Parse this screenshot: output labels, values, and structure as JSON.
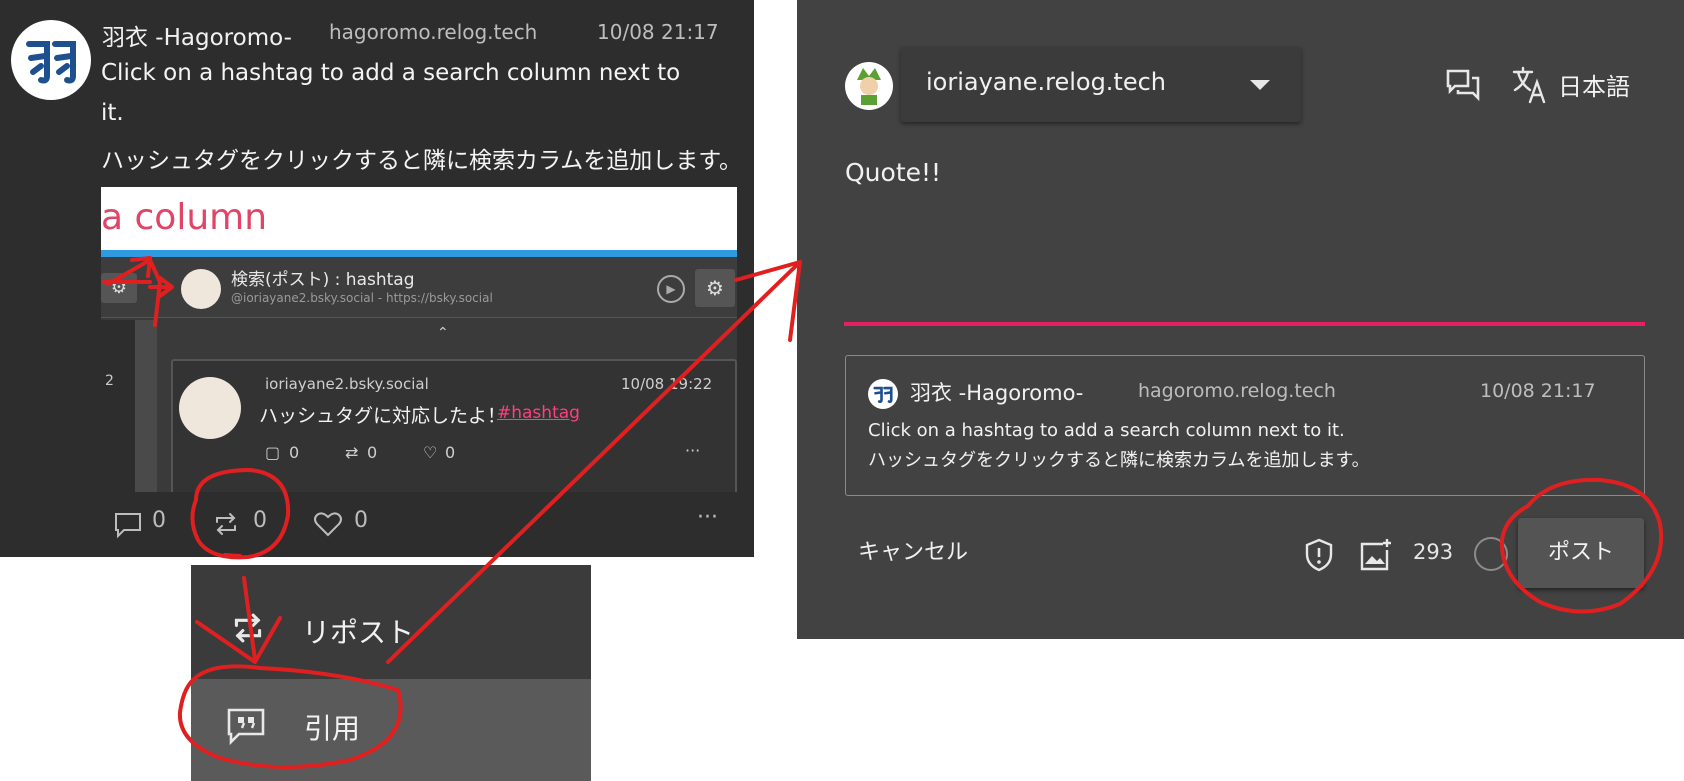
{
  "post": {
    "author_name": "羽衣 -Hagoromo-",
    "handle": "hagoromo.relog.tech",
    "time": "10/08 21:17",
    "text_lines": [
      "Click on a hashtag to add a search column next to",
      "it.",
      "ハッシュタグをクリックすると隣に検索カラムを追加します。"
    ],
    "avatar_glyph": "羽",
    "image": {
      "banner_text": "a column",
      "column_title": "検索(ポスト) : hashtag",
      "column_subtitle": "@ioriayane2.bsky.social - https://bsky.social",
      "left_column_number": "2",
      "card_handle": "ioriayane2.bsky.social",
      "card_time": "10/08 19:22",
      "card_text": "ハッシュタグに対応したよ！",
      "card_hashtag": "#hashtag",
      "card_reply_count": "0",
      "card_repost_count": "0",
      "card_like_count": "0",
      "card_more": "···"
    },
    "actions": {
      "reply_count": "0",
      "repost_count": "0",
      "like_count": "0",
      "more": "···"
    }
  },
  "repost_menu": {
    "repost_label": "リポスト",
    "quote_label": "引用"
  },
  "compose": {
    "account": "ioriayane.relog.tech",
    "language": "日本語",
    "text": "Quote!!",
    "quoted": {
      "author_name": "羽衣 -Hagoromo-",
      "handle": "hagoromo.relog.tech",
      "time": "10/08 21:17",
      "text_lines": [
        "Click on a hashtag to add a search column next to it.",
        "ハッシュタグをクリックすると隣に検索カラムを追加します。"
      ]
    },
    "cancel_label": "キャンセル",
    "char_count": "293",
    "post_label": "ポスト"
  },
  "colors": {
    "panel_bg": "#2d2d2d",
    "dialog_bg": "#424242",
    "accent": "#e91e63",
    "annotation": "#e02020"
  },
  "icons": [
    "reply-icon",
    "repost-icon",
    "like-icon",
    "more-icon",
    "quote-icon",
    "threadgate-icon",
    "translate-icon",
    "shield-icon",
    "add-image-icon",
    "settings-icon"
  ]
}
